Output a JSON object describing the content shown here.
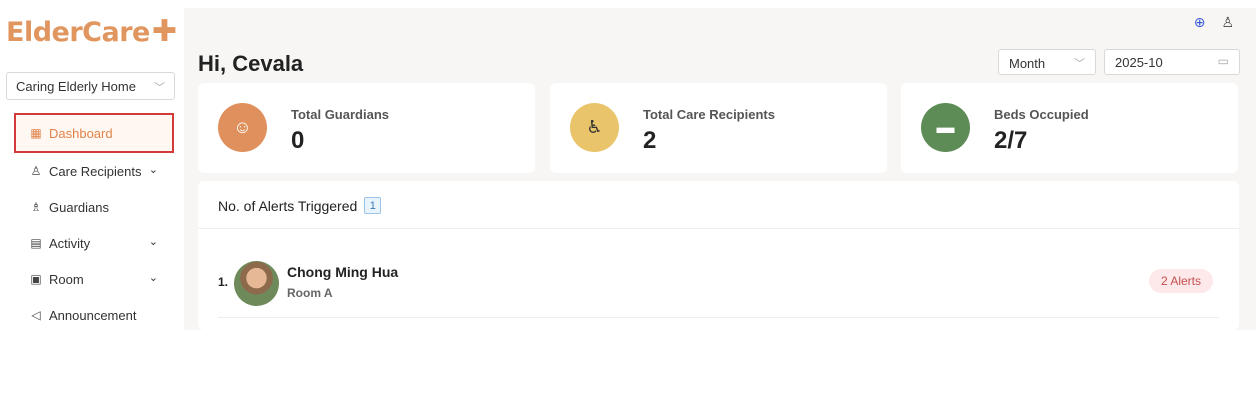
{
  "brand": {
    "name": "ElderCare",
    "plus": "✚",
    "color": "#e0965e"
  },
  "org_select": {
    "value": "Caring Elderly Home"
  },
  "nav": [
    {
      "label": "Dashboard",
      "icon": "grid-icon",
      "glyph": "▦",
      "active": true,
      "expandable": false
    },
    {
      "label": "Care Recipients",
      "icon": "care-recipient-icon",
      "glyph": "♿",
      "active": false,
      "expandable": true
    },
    {
      "label": "Guardians",
      "icon": "guardians-icon",
      "glyph": "👥",
      "active": false,
      "expandable": false
    },
    {
      "label": "Activity",
      "icon": "clipboard-icon",
      "glyph": "📋",
      "active": false,
      "expandable": true
    },
    {
      "label": "Room",
      "icon": "room-icon",
      "glyph": "🏠",
      "active": false,
      "expandable": true
    },
    {
      "label": "Announcement",
      "icon": "megaphone-icon",
      "glyph": "📢",
      "active": false,
      "expandable": false
    }
  ],
  "header": {
    "greeting": "Hi, Cevala",
    "period": "Month",
    "date": "2025-10"
  },
  "stats": [
    {
      "label": "Total Guardians",
      "value": "0",
      "icon": "person-icon",
      "glyph": "☺",
      "color": "#e0905c"
    },
    {
      "label": "Total Care Recipients",
      "value": "2",
      "icon": "elderly-icon",
      "glyph": "♿",
      "color": "#e9c46a"
    },
    {
      "label": "Beds Occupied",
      "value": "2/7",
      "icon": "bed-icon",
      "glyph": "🛏",
      "color": "#5e8c56"
    }
  ],
  "alerts": {
    "title": "No. of Alerts Triggered",
    "count": "1",
    "items": [
      {
        "number": "1.",
        "name": "Chong Ming Hua",
        "room": "Room A",
        "alerts": "2 Alerts"
      }
    ]
  }
}
